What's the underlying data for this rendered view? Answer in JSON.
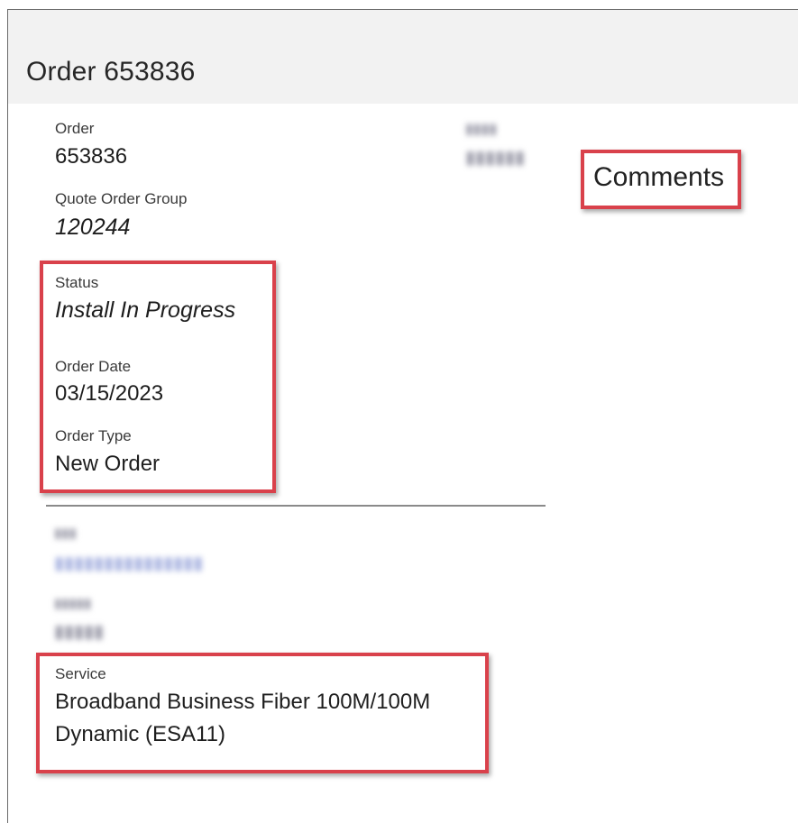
{
  "page": {
    "title": "Order 653836"
  },
  "order": {
    "label": "Order",
    "value": "653836"
  },
  "quote_order_group": {
    "label": "Quote Order Group",
    "value": "120244"
  },
  "status": {
    "label": "Status",
    "value": "Install In Progress"
  },
  "order_date": {
    "label": "Order Date",
    "value": "03/15/2023"
  },
  "order_type": {
    "label": "Order Type",
    "value": "New Order"
  },
  "service": {
    "label": "Service",
    "value_line1": "Broadband Business Fiber 100M/100M",
    "value_line2": "Dynamic (ESA11)"
  },
  "comments": {
    "label": "Comments"
  },
  "colors": {
    "highlight": "#d9414b",
    "header_band": "#f2f2f2"
  }
}
